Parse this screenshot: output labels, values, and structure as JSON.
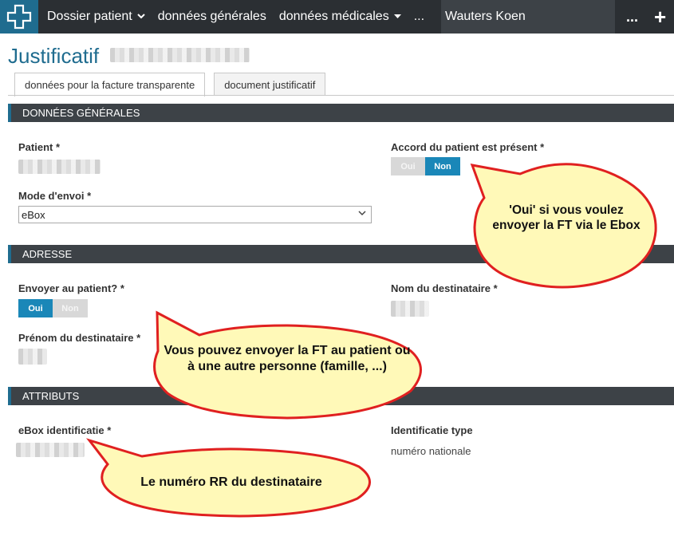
{
  "topbar": {
    "logo_icon": "medical-cross-icon",
    "nav": [
      {
        "label": "Dossier patient",
        "has_dropdown": true
      },
      {
        "label": "données générales",
        "has_dropdown": false
      },
      {
        "label": "données médicales",
        "has_dropdown": true
      }
    ],
    "overflow_label": "...",
    "user_name": "Wauters Koen",
    "more_label": "...",
    "add_label": "+"
  },
  "page": {
    "title": "Justificatif"
  },
  "tabs": [
    {
      "label": "données pour la facture transparente",
      "active": true
    },
    {
      "label": "document justificatif",
      "active": false
    }
  ],
  "sections": {
    "general": {
      "header": "DONNÉES GÉNÉRALES",
      "patient_label": "Patient *",
      "consent_label": "Accord du patient est présent *",
      "consent_toggle": {
        "yes": "Oui",
        "no": "Non",
        "selected": "no"
      },
      "send_mode_label": "Mode d'envoi *",
      "send_mode_value": "eBox"
    },
    "address": {
      "header": "ADRESSE",
      "send_to_patient_label": "Envoyer au patient? *",
      "send_to_patient_toggle": {
        "yes": "Oui",
        "no": "Non",
        "selected": "yes"
      },
      "recipient_name_label": "Nom du destinataire *",
      "recipient_firstname_label": "Prénom du destinataire *"
    },
    "attributes": {
      "header": "ATTRIBUTS",
      "ebox_id_label": "eBox identificatie *",
      "id_type_label": "Identificatie type",
      "id_type_value": "numéro nationale"
    }
  },
  "callouts": {
    "consent": "'Oui' si vous voulez envoyer la FT via le Ebox",
    "recipient": "Vous pouvez envoyer la FT au patient ou à une autre personne (famille, ...)",
    "rr_number": "Le numéro RR du destinataire"
  },
  "colors": {
    "topbar": "#2b2f33",
    "accent": "#1f6c8f",
    "toggle_on": "#1a87b8",
    "callout_fill": "#fff9b8",
    "callout_border": "#e02020"
  }
}
